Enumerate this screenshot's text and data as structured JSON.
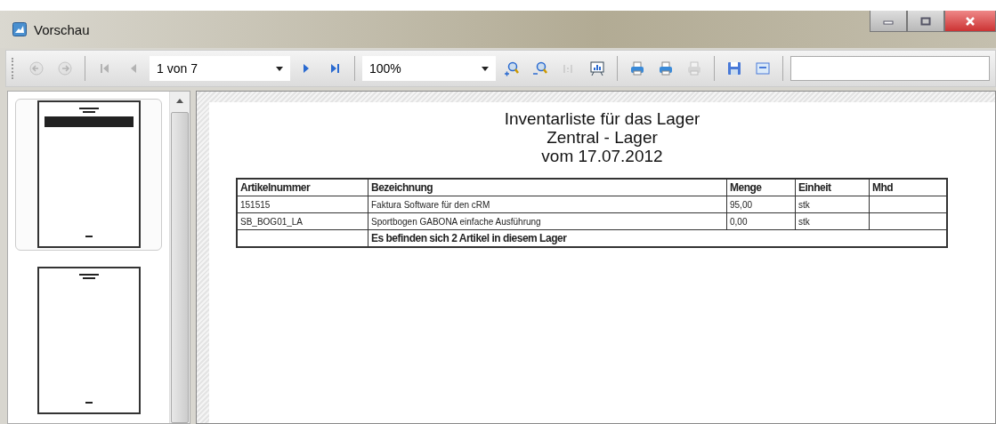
{
  "window": {
    "title": "Vorschau"
  },
  "toolbar": [
    {
      "kind": "back",
      "disabled": true
    },
    {
      "kind": "forward",
      "disabled": true
    },
    {
      "kind": "sep"
    },
    {
      "kind": "first",
      "disabled": true
    },
    {
      "kind": "prev",
      "disabled": true
    },
    {
      "kind": "combo",
      "value": "1 von 7"
    },
    {
      "kind": "next",
      "disabled": false
    },
    {
      "kind": "last",
      "disabled": false
    },
    {
      "kind": "sep"
    },
    {
      "kind": "combo",
      "value": "100%"
    },
    {
      "kind": "zoomin",
      "disabled": false
    },
    {
      "kind": "zoomout",
      "disabled": false
    },
    {
      "kind": "actual",
      "disabled": true
    },
    {
      "kind": "chart",
      "disabled": false
    },
    {
      "kind": "sep"
    },
    {
      "kind": "print",
      "disabled": false
    },
    {
      "kind": "print",
      "disabled": false
    },
    {
      "kind": "printer",
      "disabled": true
    },
    {
      "kind": "sep"
    },
    {
      "kind": "save",
      "disabled": false
    },
    {
      "kind": "export",
      "disabled": false
    },
    {
      "kind": "sep"
    },
    {
      "kind": "search"
    }
  ],
  "thumbnails": [
    {
      "selected": true,
      "has_table": true
    },
    {
      "selected": false,
      "has_table": false
    }
  ],
  "report": {
    "title_lines": [
      "Inventarliste für das Lager",
      "Zentral - Lager",
      "vom 17.07.2012"
    ],
    "columns": [
      "Artikelnummer",
      "Bezeichnung",
      "Menge",
      "Einheit",
      "Mhd"
    ],
    "rows": [
      [
        "151515",
        "Faktura Software für den cRM",
        "95,00",
        "stk",
        ""
      ],
      [
        "SB_BOG01_LA",
        "Sportbogen GABONA einfache Ausführung",
        "0,00",
        "stk",
        ""
      ]
    ],
    "summary": "Es befinden sich 2 Artikel in diesem Lager"
  }
}
